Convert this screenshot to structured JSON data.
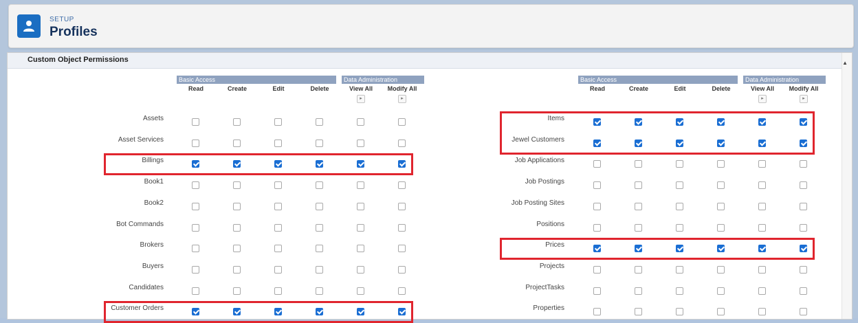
{
  "header": {
    "eyebrow": "SETUP",
    "title": "Profiles",
    "icon": "user-icon",
    "accent": "#1b6ec2"
  },
  "section": {
    "title": "Custom Object Permissions"
  },
  "group_labels": {
    "basic": "Basic Access",
    "admin": "Data Administration"
  },
  "columns": [
    "Read",
    "Create",
    "Edit",
    "Delete",
    "View All",
    "Modify All"
  ],
  "column_buttons": [
    "▸",
    "▸"
  ],
  "left_table": [
    {
      "name": "Assets",
      "checks": [
        0,
        0,
        0,
        0,
        0,
        0
      ]
    },
    {
      "name": "Asset Services",
      "checks": [
        0,
        0,
        0,
        0,
        0,
        0
      ]
    },
    {
      "name": "Billings",
      "checks": [
        1,
        1,
        1,
        1,
        1,
        1
      ]
    },
    {
      "name": "Book1",
      "checks": [
        0,
        0,
        0,
        0,
        0,
        0
      ]
    },
    {
      "name": "Book2",
      "checks": [
        0,
        0,
        0,
        0,
        0,
        0
      ]
    },
    {
      "name": "Bot Commands",
      "checks": [
        0,
        0,
        0,
        0,
        0,
        0
      ]
    },
    {
      "name": "Brokers",
      "checks": [
        0,
        0,
        0,
        0,
        0,
        0
      ]
    },
    {
      "name": "Buyers",
      "checks": [
        0,
        0,
        0,
        0,
        0,
        0
      ]
    },
    {
      "name": "Candidates",
      "checks": [
        0,
        0,
        0,
        0,
        0,
        0
      ]
    },
    {
      "name": "Customer Orders",
      "checks": [
        1,
        1,
        1,
        1,
        1,
        1
      ]
    }
  ],
  "right_table": [
    {
      "name": "Items",
      "checks": [
        1,
        1,
        1,
        1,
        1,
        1
      ]
    },
    {
      "name": "Jewel Customers",
      "checks": [
        1,
        1,
        1,
        1,
        1,
        1
      ]
    },
    {
      "name": "Job Applications",
      "checks": [
        0,
        0,
        0,
        0,
        0,
        0
      ]
    },
    {
      "name": "Job Postings",
      "checks": [
        0,
        0,
        0,
        0,
        0,
        0
      ]
    },
    {
      "name": "Job Posting Sites",
      "checks": [
        0,
        0,
        0,
        0,
        0,
        0
      ]
    },
    {
      "name": "Positions",
      "checks": [
        0,
        0,
        0,
        0,
        0,
        0
      ]
    },
    {
      "name": "Prices",
      "checks": [
        1,
        1,
        1,
        1,
        1,
        1
      ]
    },
    {
      "name": "Projects",
      "checks": [
        0,
        0,
        0,
        0,
        0,
        0
      ]
    },
    {
      "name": "ProjectTasks",
      "checks": [
        0,
        0,
        0,
        0,
        0,
        0
      ]
    },
    {
      "name": "Properties",
      "checks": [
        0,
        0,
        0,
        0,
        0,
        0
      ]
    }
  ],
  "highlight_color": "#e0252e"
}
